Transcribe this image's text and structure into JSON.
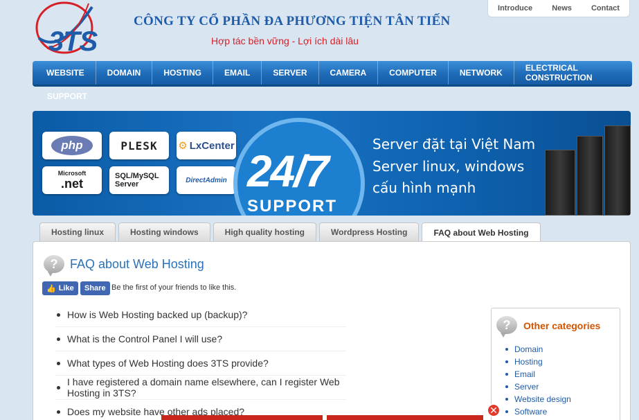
{
  "top_links": [
    "Introduce",
    "News",
    "Contact"
  ],
  "header": {
    "logo_text": "3TS",
    "company_name": "CÔNG TY CỔ PHẦN ĐA PHƯƠNG TIỆN TÂN TIẾN",
    "slogan": "Hợp tác bền vững - Lợi ích dài lâu"
  },
  "nav": {
    "items": [
      "WEBSITE",
      "DOMAIN",
      "HOSTING",
      "EMAIL",
      "SERVER",
      "CAMERA",
      "COMPUTER",
      "NETWORK",
      "ELECTRICAL CONSTRUCTION"
    ],
    "support": "SUPPORT"
  },
  "banner": {
    "logos": [
      "php",
      "PLESK",
      "LxCenter",
      "Microsoft",
      ".net",
      "SQL/MySQL",
      "Server",
      "DirectAdmin"
    ],
    "big_text": "24/7",
    "support_text": "SUPPORT",
    "lines": [
      "Server đặt tại Việt Nam",
      "Server linux, windows",
      "cấu hình mạnh"
    ]
  },
  "tabs": [
    {
      "label": "Hosting linux",
      "active": false
    },
    {
      "label": "Hosting windows",
      "active": false
    },
    {
      "label": "High quality hosting",
      "active": false
    },
    {
      "label": "Wordpress Hosting",
      "active": false
    },
    {
      "label": "FAQ about Web Hosting",
      "active": true
    }
  ],
  "content": {
    "title": "FAQ about Web Hosting",
    "like_label": "Like",
    "share_label": "Share",
    "social_text": "Be the first of your friends to like this.",
    "faq_items": [
      "How is Web Hosting backed up (backup)?",
      "What is the Control Panel I will use?",
      "What types of Web Hosting does 3TS provide?",
      "I have registered a domain name elsewhere, can I register Web Hosting in 3TS?",
      "Does my website have other ads placed?"
    ]
  },
  "sidebar": {
    "title": "Other categories",
    "items": [
      "Domain",
      "Hosting",
      "Email",
      "Server",
      "Website design",
      "Software"
    ]
  },
  "colors": {
    "nav_blue": "#1f6bb8",
    "brand_blue": "#1e5ba8",
    "slogan_red": "#d61f26",
    "sidebar_title": "#d35400"
  }
}
